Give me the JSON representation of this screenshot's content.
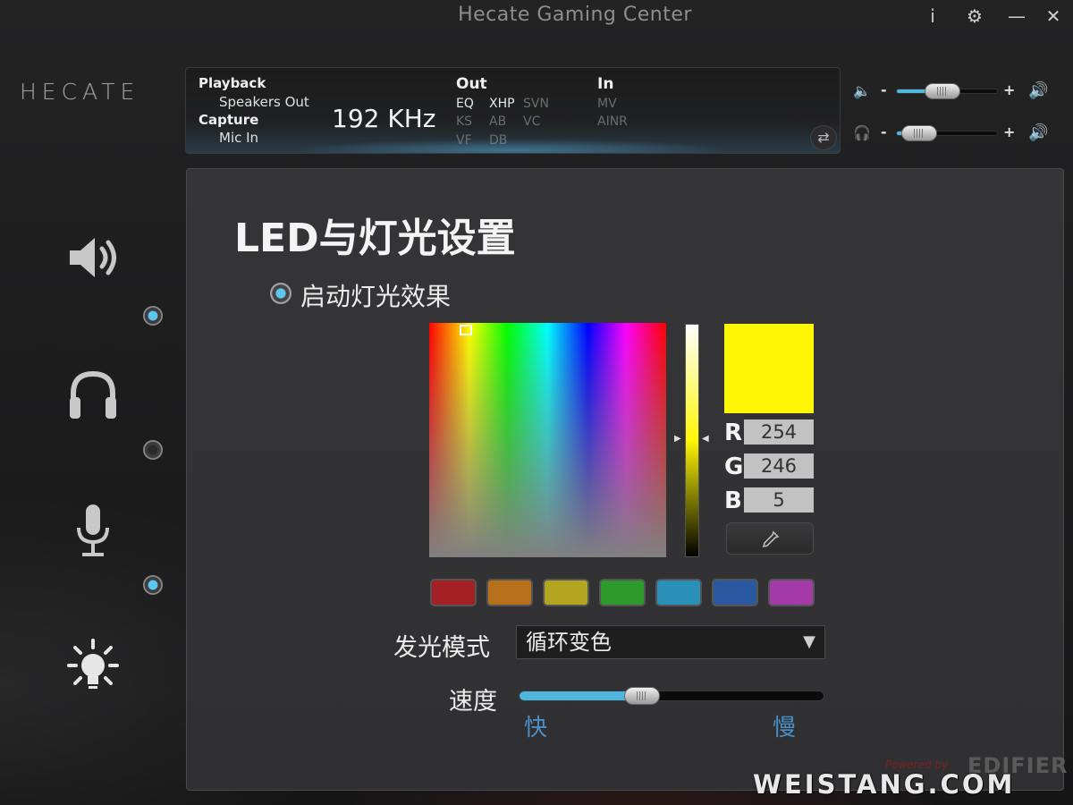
{
  "window": {
    "title": "Hecate Gaming Center",
    "info_icon": "i",
    "settings_icon": "⚙",
    "minimize_icon": "—",
    "close_icon": "✕"
  },
  "logo": {
    "text": "HECATE"
  },
  "info": {
    "playback_label": "Playback",
    "playback_device": "Speakers Out",
    "capture_label": "Capture",
    "capture_device": "Mic In",
    "sample_rate": "192 KHz",
    "out_label": "Out",
    "out_features": [
      {
        "label": "EQ",
        "active": true
      },
      {
        "label": "XHP",
        "active": true
      },
      {
        "label": "SVN",
        "active": false
      },
      {
        "label": "KS",
        "active": false
      },
      {
        "label": "AB",
        "active": false
      },
      {
        "label": "VC",
        "active": false
      },
      {
        "label": "VF",
        "active": false
      },
      {
        "label": "DB",
        "active": false
      }
    ],
    "in_label": "In",
    "in_features": [
      {
        "label": "MV",
        "active": false
      },
      {
        "label": "AINR",
        "active": false
      }
    ]
  },
  "volume": {
    "speaker_level": 0.45,
    "headphone_level": 0.22,
    "minus": "-",
    "plus": "+"
  },
  "sidebar": {
    "items": [
      {
        "name": "speaker",
        "enabled": true
      },
      {
        "name": "headphone",
        "enabled": false
      },
      {
        "name": "microphone",
        "enabled": true
      },
      {
        "name": "led",
        "enabled": null
      }
    ]
  },
  "main": {
    "title": "LED与灯光设置",
    "enable_label": "启动灯光效果",
    "color": {
      "hex": "#FEF605",
      "r_label": "R",
      "g_label": "G",
      "b_label": "B",
      "r": "254",
      "g": "246",
      "b": "5"
    },
    "presets": [
      "#a32025",
      "#b8701c",
      "#b4a520",
      "#2e9a2b",
      "#2a90b8",
      "#2a58a0",
      "#a43aa8"
    ],
    "mode_label": "发光模式",
    "mode_value": "循环变色",
    "speed_label": "速度",
    "speed_level": 0.4,
    "speed_fast": "快",
    "speed_slow": "慢"
  },
  "footer": {
    "powered": "Powered by",
    "brand": "EDIFIER",
    "watermark": "WEISTANG.COM"
  }
}
